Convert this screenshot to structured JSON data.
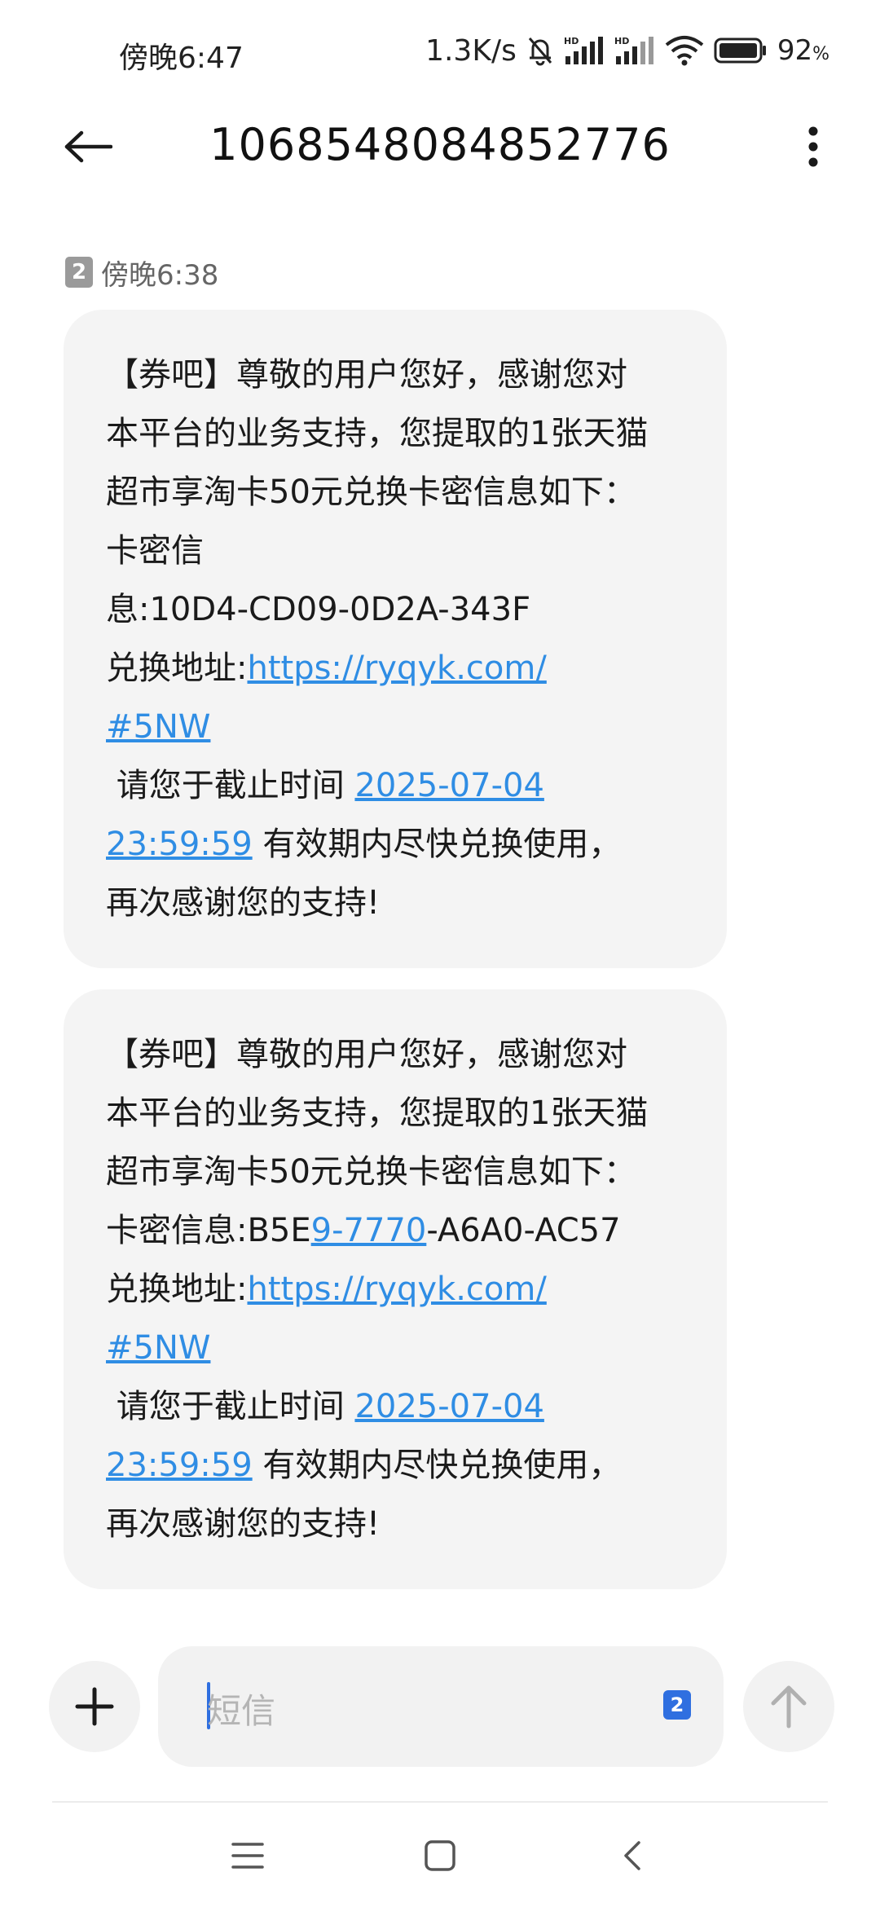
{
  "status_bar": {
    "time": "傍晚6:47",
    "network_speed": "1.3K/s",
    "battery_percent": "92",
    "battery_unit": "%",
    "icons": [
      "mute-bell-icon",
      "hd-signal-icon",
      "hd-signal-icon",
      "wifi-icon",
      "battery-icon"
    ]
  },
  "header": {
    "title": "1068548084852776",
    "back_icon": "back-arrow-icon",
    "more_icon": "more-vertical-icon"
  },
  "conversation": {
    "sim_badge": "2",
    "timestamp": "傍晚6:38",
    "messages": [
      {
        "lines": [
          "【券吧】尊敬的用户您好，感谢您对",
          "本平台的业务支持，您提取的1张天猫",
          "超市享淘卡50元兑换卡密信息如下：",
          "卡密信",
          "息:10D4-CD09-0D2A-343F"
        ],
        "url_prefix": "兑换地址:",
        "url_line1": "https://ryqyk.com/",
        "url_line2": "#5NW",
        "deadline_prefix": " 请您于截止时间 ",
        "deadline_date": "2025-07-04",
        "deadline_time": "23:59:59",
        "deadline_suffix": " 有效期内尽快兑换使用，",
        "closing": "再次感谢您的支持!"
      },
      {
        "lines": [
          "【券吧】尊敬的用户您好，感谢您对",
          "本平台的业务支持，您提取的1张天猫",
          "超市享淘卡50元兑换卡密信息如下："
        ],
        "code_prefix": "卡密信息:B5E",
        "code_link": "9-7770",
        "code_suffix": "-A6A0-AC57",
        "url_prefix": "兑换地址:",
        "url_line1": "https://ryqyk.com/",
        "url_line2": "#5NW",
        "deadline_prefix": " 请您于截止时间 ",
        "deadline_date": "2025-07-04",
        "deadline_time": "23:59:59",
        "deadline_suffix": " 有效期内尽快兑换使用，",
        "closing": "再次感谢您的支持!"
      }
    ]
  },
  "composer": {
    "placeholder": "短信",
    "sim_select": "2",
    "add_icon": "plus-icon",
    "send_icon": "send-arrow-up-icon"
  },
  "nav_bar": {
    "icons": [
      "menu-icon",
      "home-square-icon",
      "back-chevron-icon"
    ]
  },
  "colors": {
    "link": "#2f8de4",
    "bubble_bg": "#f4f4f4",
    "accent": "#2f6fe0"
  }
}
